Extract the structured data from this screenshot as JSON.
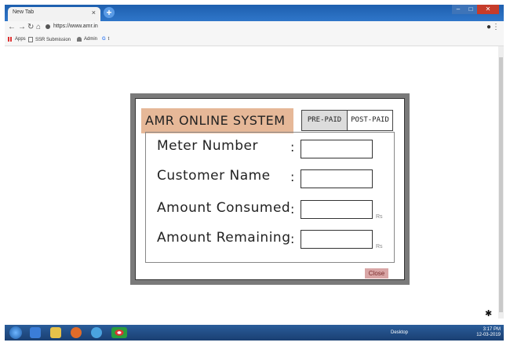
{
  "browser": {
    "tab_title": "New Tab",
    "tab_close": "×",
    "new_tab": "+",
    "url": "https://www.amr.in",
    "account_icon": "account-circle-icon",
    "menu_icon": "kebab-menu-icon",
    "bookmarks": [
      {
        "label": "Apps",
        "icon": "apps-grid-icon"
      },
      {
        "label": "SSR Submission",
        "icon": "page-icon"
      },
      {
        "label": "Admin",
        "icon": "user-icon"
      },
      {
        "label": "t",
        "icon": "google-icon"
      }
    ]
  },
  "app": {
    "title": "AMR ONLINE SYSTEM",
    "modes": [
      "PRE-PAID",
      "POST-PAID"
    ],
    "active_mode": "PRE-PAID",
    "fields": [
      {
        "label": "Meter Number",
        "colon": ":",
        "value": "",
        "unit": ""
      },
      {
        "label": "Customer Name",
        "colon": ":",
        "value": "",
        "unit": ""
      },
      {
        "label": "Amount Consumed",
        "colon": ":",
        "value": "",
        "unit": "Rs"
      },
      {
        "label": "Amount Remaining",
        "colon": ":",
        "value": "",
        "unit": "Rs"
      }
    ],
    "close_label": "Close"
  },
  "taskbar": {
    "desktop_label": "Desktop",
    "time": "3:17 PM",
    "date": "12-03-2019"
  },
  "colors": {
    "title_bg": "#e6b898",
    "close_bg": "#d9a6a6",
    "panel_frame": "#7a7a7a",
    "taskbar": "#1f4c86"
  }
}
